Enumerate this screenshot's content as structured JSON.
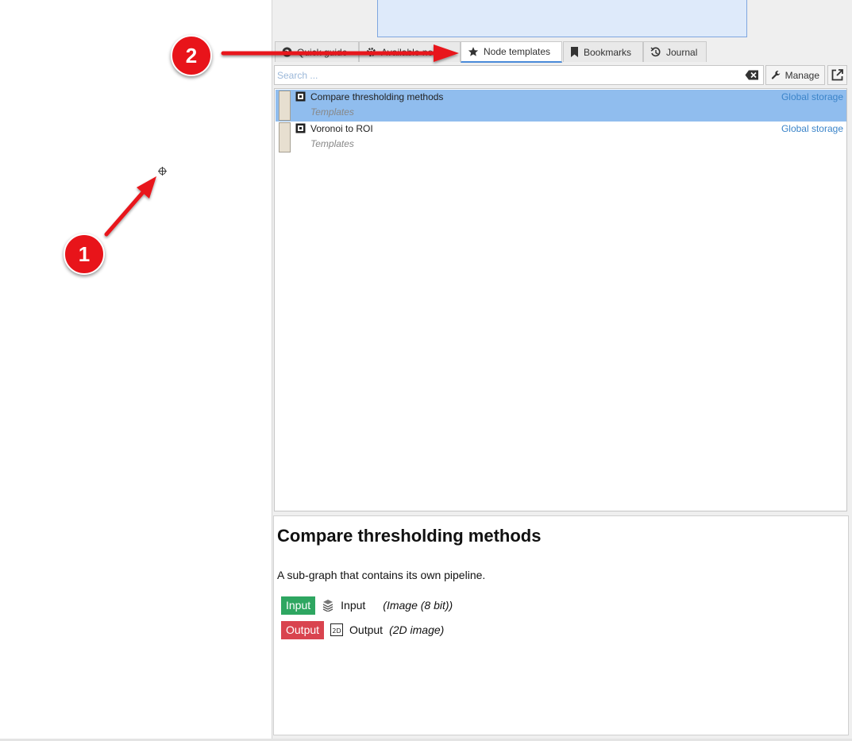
{
  "tabs": [
    {
      "label": "Quick guide",
      "icon": "question-icon"
    },
    {
      "label": "Available no",
      "icon": "gear-icon"
    },
    {
      "label": "Node templates",
      "icon": "star-icon",
      "active": true
    },
    {
      "label": "Bookmarks",
      "icon": "bookmark-icon"
    },
    {
      "label": "Journal",
      "icon": "journal-icon"
    }
  ],
  "search": {
    "placeholder": "Search ...",
    "value": ""
  },
  "toolbar": {
    "manage_label": "Manage"
  },
  "templates": [
    {
      "title": "Compare thresholding methods",
      "subtitle": "Templates",
      "storage": "Global storage",
      "selected": true
    },
    {
      "title": "Voronoi to ROI",
      "subtitle": "Templates",
      "storage": "Global storage",
      "selected": false
    }
  ],
  "details": {
    "title": "Compare thresholding methods",
    "description": "A sub-graph that contains its own pipeline.",
    "input": {
      "badge": "Input",
      "name": "Input",
      "type": "(Image (8 bit))"
    },
    "output": {
      "badge": "Output",
      "name": "Output",
      "type": "(2D image)"
    }
  },
  "callouts": {
    "one": "1",
    "two": "2"
  },
  "colors": {
    "selection": "#90bdee",
    "accent": "#4a8ad8",
    "input_badge": "#2ea661",
    "output_badge": "#d9444f",
    "callout": "#e8141a"
  }
}
